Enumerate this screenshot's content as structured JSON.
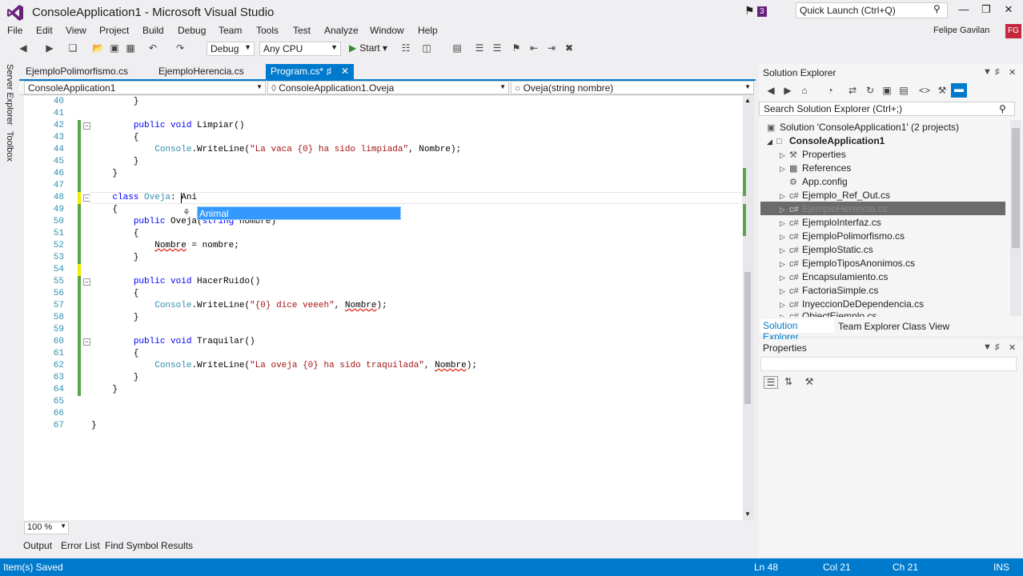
{
  "window": {
    "title": "ConsoleApplication1 - Microsoft Visual Studio",
    "notification_count": "3",
    "quick_launch_placeholder": "Quick Launch (Ctrl+Q)",
    "user_name": "Felipe Gavilan",
    "user_initials": "FG"
  },
  "menu": [
    "File",
    "Edit",
    "View",
    "Project",
    "Build",
    "Debug",
    "Team",
    "Tools",
    "Test",
    "Analyze",
    "Window",
    "Help"
  ],
  "toolbar": {
    "configuration": "Debug",
    "platform": "Any CPU",
    "start_label": "Start"
  },
  "left_rail": {
    "server_explorer": "Server Explorer",
    "toolbox": "Toolbox"
  },
  "doc_tabs": {
    "tab1": "EjemploPolimorfismo.cs",
    "tab2": "EjemploHerencia.cs",
    "active": "Program.cs*"
  },
  "navbar": {
    "project": "ConsoleApplication1",
    "type": "ConsoleApplication1.Oveja",
    "member": "Oveja(string nombre)"
  },
  "editor": {
    "line_numbers": [
      "40",
      "41",
      "42",
      "43",
      "44",
      "45",
      "46",
      "47",
      "48",
      "49",
      "50",
      "51",
      "52",
      "53",
      "54",
      "55",
      "56",
      "57",
      "58",
      "59",
      "60",
      "61",
      "62",
      "63",
      "64",
      "65",
      "66",
      "67"
    ],
    "intellisense_item": "Animal",
    "zoom": "100 %"
  },
  "bottom_tabs": [
    "Output",
    "Error List",
    "Find Symbol Results"
  ],
  "status": {
    "message": "Item(s) Saved",
    "line": "Ln 48",
    "col": "Col 21",
    "ch": "Ch 21",
    "mode": "INS"
  },
  "solution_explorer": {
    "title": "Solution Explorer",
    "search_placeholder": "Search Solution Explorer (Ctrl+;)",
    "solution": "Solution 'ConsoleApplication1' (2 projects)",
    "project": "ConsoleApplication1",
    "items": [
      "Properties",
      "References",
      "App.config",
      "Ejemplo_Ref_Out.cs",
      "EjemploHerencia.cs",
      "EjemploInterfaz.cs",
      "EjemploPolimorfismo.cs",
      "EjemploStatic.cs",
      "EjemploTiposAnonimos.cs",
      "Encapsulamiento.cs",
      "FactoriaSimple.cs",
      "InyeccionDeDependencia.cs",
      "ObjectEjemplo.cs"
    ],
    "tabs": [
      "Solution Explorer",
      "Team Explorer",
      "Class View"
    ]
  },
  "properties": {
    "title": "Properties"
  },
  "colors": {
    "accent": "#007acc",
    "vs_purple": "#68217a",
    "keyword": "#0000ff",
    "string": "#a31515",
    "type": "#2b91af",
    "change_saved": "#57a64a",
    "change_unsaved": "#efef00"
  }
}
